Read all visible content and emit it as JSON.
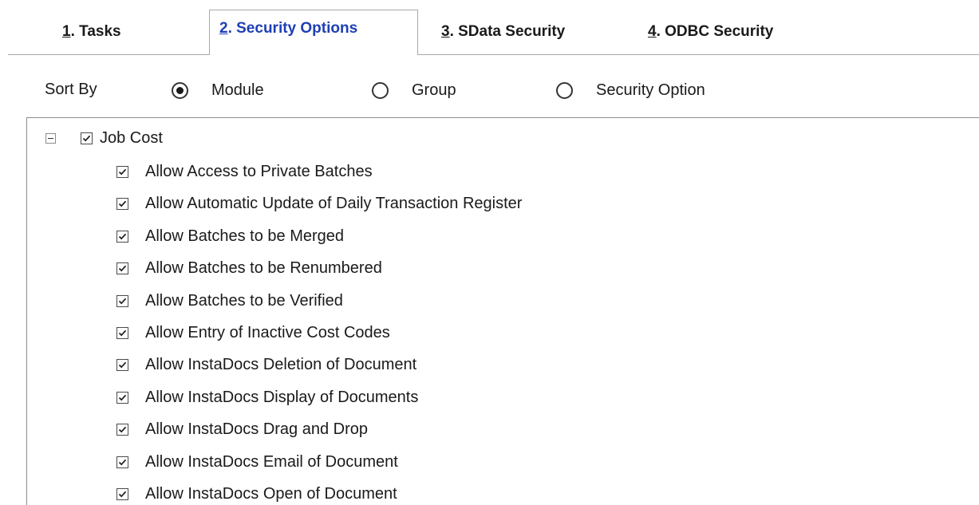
{
  "tabs": [
    {
      "mnemonic": "1",
      "label": ". Tasks",
      "active": false
    },
    {
      "mnemonic": "2",
      "label": ". Security Options",
      "active": true
    },
    {
      "mnemonic": "3",
      "label": ". SData Security",
      "active": false
    },
    {
      "mnemonic": "4",
      "label": ". ODBC Security",
      "active": false
    }
  ],
  "sort": {
    "label": "Sort By",
    "options": [
      {
        "label": "Module",
        "selected": true
      },
      {
        "label": "Group",
        "selected": false
      },
      {
        "label": "Security Option",
        "selected": false
      }
    ]
  },
  "tree": {
    "root": {
      "label": "Job Cost",
      "checked": true,
      "expanded": true
    },
    "items": [
      {
        "label": "Allow Access to Private Batches",
        "checked": true
      },
      {
        "label": "Allow Automatic Update of Daily Transaction Register",
        "checked": true
      },
      {
        "label": "Allow Batches to be Merged",
        "checked": true
      },
      {
        "label": "Allow Batches to be Renumbered",
        "checked": true
      },
      {
        "label": "Allow Batches to be Verified",
        "checked": true
      },
      {
        "label": "Allow Entry of Inactive Cost Codes",
        "checked": true
      },
      {
        "label": "Allow InstaDocs Deletion of Document",
        "checked": true
      },
      {
        "label": "Allow InstaDocs Display of Documents",
        "checked": true
      },
      {
        "label": "Allow InstaDocs Drag and Drop",
        "checked": true
      },
      {
        "label": "Allow InstaDocs Email of Document",
        "checked": true
      },
      {
        "label": "Allow InstaDocs Open of Document",
        "checked": true
      }
    ]
  },
  "colors": {
    "active_tab_text": "#1e3fb4",
    "border": "#a9a9a9"
  }
}
